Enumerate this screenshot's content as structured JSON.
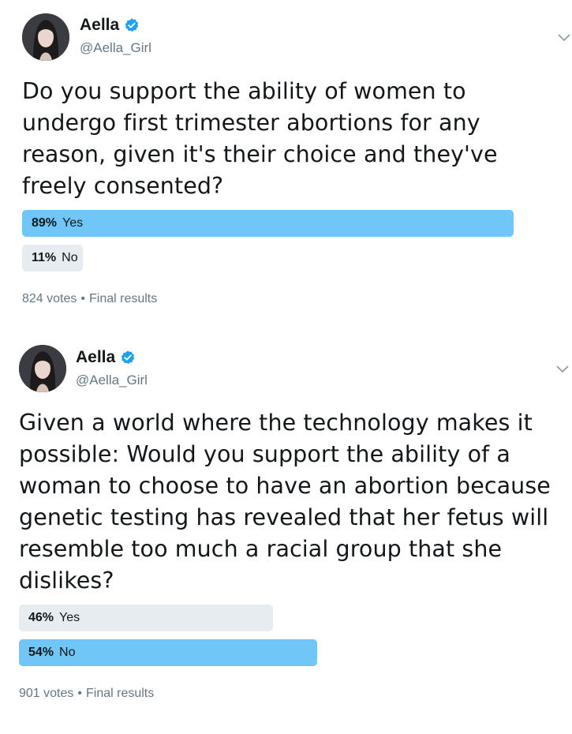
{
  "tweets": [
    {
      "author": {
        "display_name": "Aella",
        "handle": "@Aella_Girl",
        "verified": true
      },
      "text": "Do you support the ability of women to undergo first trimester abortions for any reason, given it's their choice and they've freely consented?",
      "poll": {
        "options": [
          {
            "label": "Yes",
            "percent_text": "89%",
            "percent": 89,
            "winner": true
          },
          {
            "label": "No",
            "percent_text": "11%",
            "percent": 11,
            "winner": false
          }
        ],
        "votes": "824 votes",
        "status": "Final results"
      }
    },
    {
      "author": {
        "display_name": "Aella",
        "handle": "@Aella_Girl",
        "verified": true
      },
      "text": "Given a world where the technology makes it possible: Would you support the ability of a woman to choose to have an abortion because genetic testing has revealed that her fetus will resemble too much a racial group that she dislikes?",
      "poll": {
        "options": [
          {
            "label": "Yes",
            "percent_text": "46%",
            "percent": 46,
            "winner": false
          },
          {
            "label": "No",
            "percent_text": "54%",
            "percent": 54,
            "winner": true
          }
        ],
        "votes": "901 votes",
        "status": "Final results"
      }
    }
  ],
  "colors": {
    "winner_bar": "#71c6f8",
    "loser_bar": "#e6ecf0",
    "verified_badge": "#1da1f2",
    "secondary_text": "#657786"
  },
  "icons": {
    "verified": "verified-badge-icon",
    "menu": "chevron-down-icon"
  }
}
